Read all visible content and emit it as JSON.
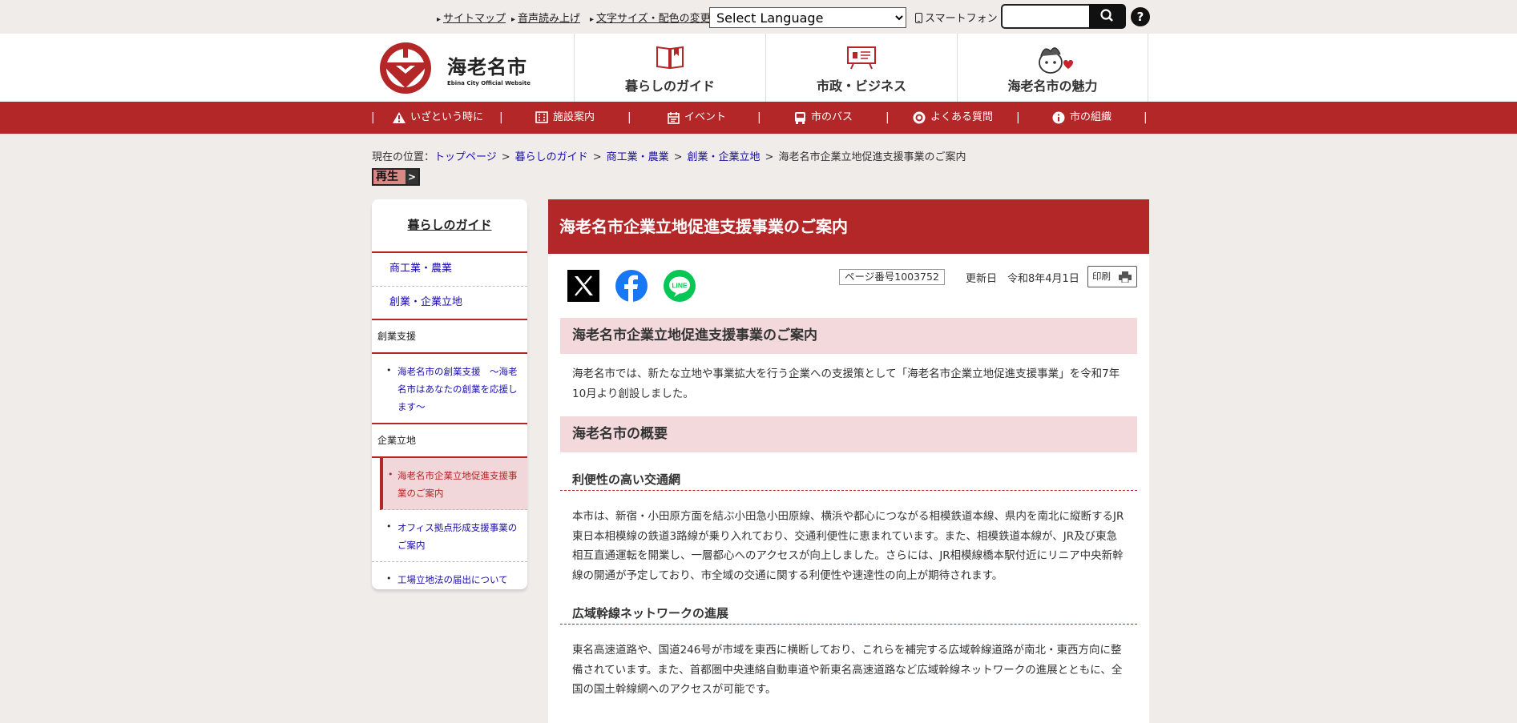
{
  "utility": {
    "links": [
      "サイトマップ",
      "音声読み上げ",
      "文字サイズ・配色の変更"
    ],
    "language_select": "Select Language",
    "smartphone": "スマートフォン",
    "help": "?"
  },
  "header": {
    "logo_title": "海老名市",
    "logo_subtitle": "Ebina City Official Website",
    "nav": [
      "暮らしのガイド",
      "市政・ビジネス",
      "海老名市の魅力"
    ]
  },
  "redbar": {
    "items": [
      "いざという時に",
      "施設案内",
      "イベント",
      "市のバス",
      "よくある質問",
      "市の組織"
    ],
    "separator": "|"
  },
  "breadcrumb": {
    "prefix": "現在の位置：",
    "links": [
      "トップページ",
      "暮らしのガイド",
      "商工業・農業",
      "創業・企業立地"
    ],
    "current": "海老名市企業立地促進支援事業のご案内",
    "sep": ">"
  },
  "play": "再生",
  "sidebar": {
    "heading": "暮らしのガイド",
    "level2": [
      "商工業・農業",
      "創業・企業立地"
    ],
    "categories": [
      {
        "title": "創業支援",
        "items": [
          "海老名市の創業支援　～海老名市はあなたの創業を応援します～"
        ]
      },
      {
        "title": "企業立地",
        "items": [
          "海老名市企業立地促進支援事業のご案内",
          "オフィス拠点形成支援事業のご案内",
          "工場立地法の届出について"
        ]
      }
    ]
  },
  "main": {
    "title": "海老名市企業立地促進支援事業のご案内",
    "page_number": "ページ番号1003752",
    "updated": "更新日　令和8年4月1日",
    "print": "印刷",
    "line_label": "LINE",
    "h2_1": "海老名市企業立地促進支援事業のご案内",
    "intro": "海老名市では、新たな立地や事業拡大を行う企業への支援策として「海老名市企業立地促進支援事業」を令和7年10月より創設しました。",
    "h2_2": "海老名市の概要",
    "h3_1": "利便性の高い交通網",
    "p1": "本市は、新宿・小田原方面を結ぶ小田急小田原線、横浜や都心につながる相模鉄道本線、県内を南北に縦断するJR東日本相模線の鉄道3路線が乗り入れており、交通利便性に恵まれています。また、相模鉄道本線が、JR及び東急相互直通運転を開業し、一層都心へのアクセスが向上しました。さらには、JR相模線橋本駅付近にリニア中央新幹線の開通が予定しており、市全域の交通に関する利便性や速達性の向上が期待されます。",
    "h3_2": "広域幹線ネットワークの進展",
    "p2": "東名高速道路や、国道246号が市域を東西に横断しており、これらを補完する広域幹線道路が南北・東西方向に整備されています。また、首都圏中央連絡自動車道や新東名高速道路など広域幹線ネットワークの進展とともに、全国の国土幹線網へのアクセスが可能です。"
  },
  "colors": {
    "accent_red": "#b32728",
    "heading_pink": "#f3d8dc",
    "background": "#efecea"
  }
}
